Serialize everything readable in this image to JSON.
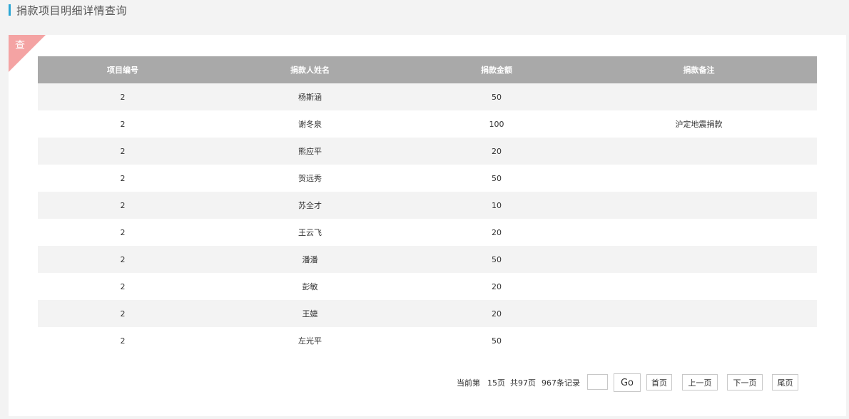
{
  "header": {
    "title": "捐款项目明细详情查询"
  },
  "panel": {
    "badge_label": "查"
  },
  "table": {
    "columns": [
      "项目编号",
      "捐款人姓名",
      "捐款金额",
      "捐款备注"
    ],
    "rows": [
      {
        "project_id": "2",
        "donor": "杨斯涵",
        "amount": "50",
        "note": ""
      },
      {
        "project_id": "2",
        "donor": "谢冬泉",
        "amount": "100",
        "note": "沪定地震捐款"
      },
      {
        "project_id": "2",
        "donor": "熊应平",
        "amount": "20",
        "note": ""
      },
      {
        "project_id": "2",
        "donor": "贺远秀",
        "amount": "50",
        "note": ""
      },
      {
        "project_id": "2",
        "donor": "苏全才",
        "amount": "10",
        "note": ""
      },
      {
        "project_id": "2",
        "donor": "王云飞",
        "amount": "20",
        "note": ""
      },
      {
        "project_id": "2",
        "donor": "潘潘",
        "amount": "50",
        "note": ""
      },
      {
        "project_id": "2",
        "donor": "彭敏",
        "amount": "20",
        "note": ""
      },
      {
        "project_id": "2",
        "donor": "王婕",
        "amount": "20",
        "note": ""
      },
      {
        "project_id": "2",
        "donor": "左光平",
        "amount": "50",
        "note": ""
      }
    ]
  },
  "pager": {
    "current_page": "当前第",
    "current_page_value": "15页",
    "total_pages": "共97页",
    "total_records": "967条记录",
    "page_input_value": "",
    "go_label": "Go",
    "first_label": "首页",
    "prev_label": "上一页",
    "next_label": "下一页",
    "last_label": "尾页"
  }
}
